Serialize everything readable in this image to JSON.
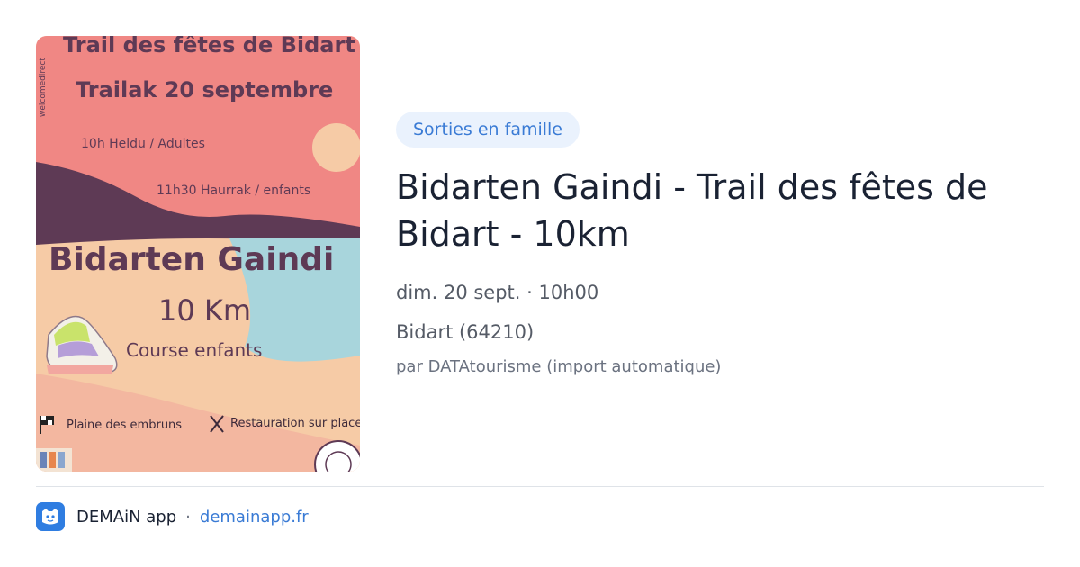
{
  "poster": {
    "line1": "Trail des fêtes de Bidart",
    "line2": "Trailak 20 septembre",
    "line3": "10h Heldu / Adultes",
    "line4": "11h30 Haurrak / enfants",
    "headline": "Bidarten Gaindi",
    "distance": "10 Km",
    "kids": "Course enfants",
    "place": "Plaine des embruns",
    "food": "Restauration sur place",
    "side_text": "welcomedirect"
  },
  "event": {
    "category": "Sorties en famille",
    "title": "Bidarten Gaindi - Trail des fêtes de Bidart - 10km",
    "datetime": "dim. 20 sept. · 10h00",
    "location": "Bidart (64210)",
    "source": "par DATAtourisme (import automatique)"
  },
  "footer": {
    "app_name": "DEMAiN app",
    "separator": "·",
    "domain": "demainapp.fr"
  },
  "colors": {
    "accent": "#3a7bd5",
    "tag_bg": "#eaf2fd",
    "poster_pink": "#f08784",
    "poster_peach": "#f6cba6",
    "poster_blue": "#a8d5dc",
    "poster_plum": "#5e3a55"
  }
}
